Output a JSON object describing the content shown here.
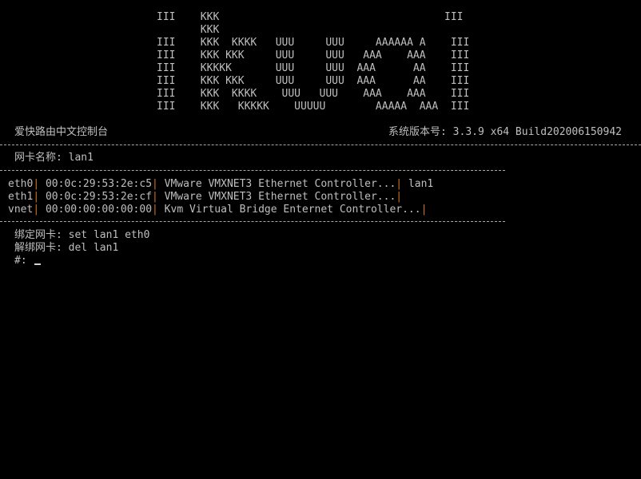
{
  "banner": {
    "ascii_art": "III    KKK                                    III\n       KKK\nIII    KKK  KKKK   UUU     UUU     AAAAAA A    III\nIII    KKK KKK     UUU     UUU   AAA    AAA    III\nIII    KKKKK       UUU     UUU  AAA      AA    III\nIII    KKK KKK     UUU     UUU  AAA      AA    III\nIII    KKK  KKKK    UUU   UUU    AAA    AAA    III\nIII    KKK   KKKKK    UUUUU        AAAAA  AAA  III"
  },
  "header": {
    "app_title": "爱快路由中文控制台",
    "version_label": "系统版本号: 3.3.9 x64 Build202006150942"
  },
  "nic_label": "网卡名称: lan1",
  "separator_char": "|",
  "colors": {
    "background": "#000000",
    "text": "#bfbfbf",
    "separator_bar": "#c8752a"
  },
  "interfaces": [
    {
      "name": "eth0",
      "mac": " 00:0c:29:53:2e:c5",
      "description": " VMware VMXNET3 Ethernet Controller...",
      "binding": " lan1"
    },
    {
      "name": "eth1",
      "mac": " 00:0c:29:53:2e:cf",
      "description": " VMware VMXNET3 Ethernet Controller...",
      "binding": ""
    },
    {
      "name": "vnet",
      "mac": " 00:00:00:00:00:00",
      "description": " Kvm Virtual Bridge Enternet Controller...",
      "binding": ""
    }
  ],
  "help": {
    "bind": "绑定网卡: set lan1 eth0",
    "unbind": "解绑网卡: del lan1"
  },
  "prompt": "#: "
}
